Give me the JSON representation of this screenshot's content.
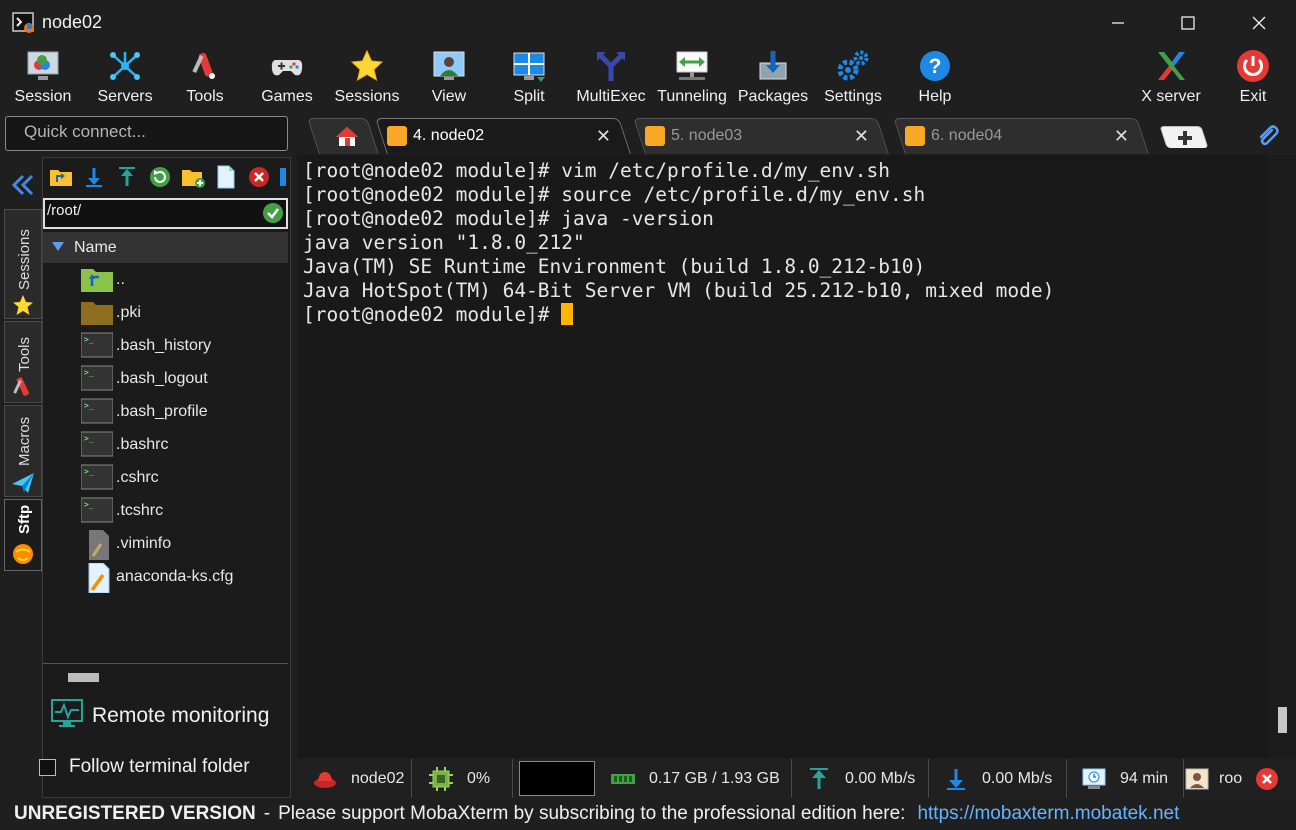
{
  "window": {
    "title": "node02"
  },
  "toolbar": {
    "items": [
      {
        "label": "Session",
        "icon": "session-icon"
      },
      {
        "label": "Servers",
        "icon": "servers-icon"
      },
      {
        "label": "Tools",
        "icon": "tools-icon"
      },
      {
        "label": "Games",
        "icon": "gamepad-icon"
      },
      {
        "label": "Sessions",
        "icon": "star-icon"
      },
      {
        "label": "View",
        "icon": "view-icon"
      },
      {
        "label": "Split",
        "icon": "split-icon"
      },
      {
        "label": "MultiExec",
        "icon": "fork-icon"
      },
      {
        "label": "Tunneling",
        "icon": "tunnel-icon"
      },
      {
        "label": "Packages",
        "icon": "package-icon"
      },
      {
        "label": "Settings",
        "icon": "gears-icon"
      },
      {
        "label": "Help",
        "icon": "help-icon"
      },
      {
        "label": "X server",
        "icon": "x-server-icon"
      },
      {
        "label": "Exit",
        "icon": "power-icon"
      }
    ]
  },
  "quick_connect": {
    "placeholder": "Quick connect..."
  },
  "tabs": [
    {
      "label": "4. node02",
      "active": true
    },
    {
      "label": "5. node03",
      "active": false
    },
    {
      "label": "6. node04",
      "active": false
    }
  ],
  "sidebar": {
    "vtabs": [
      {
        "label": "Sessions"
      },
      {
        "label": "Tools"
      },
      {
        "label": "Macros"
      },
      {
        "label": "Sftp"
      }
    ]
  },
  "sftp": {
    "path": "/root/",
    "column_name": "Name",
    "files": [
      {
        "name": "..",
        "type": "parent"
      },
      {
        "name": ".pki",
        "type": "folder"
      },
      {
        "name": ".bash_history",
        "type": "script"
      },
      {
        "name": ".bash_logout",
        "type": "script"
      },
      {
        "name": ".bash_profile",
        "type": "script"
      },
      {
        "name": ".bashrc",
        "type": "script"
      },
      {
        "name": ".cshrc",
        "type": "script"
      },
      {
        "name": ".tcshrc",
        "type": "script"
      },
      {
        "name": ".viminfo",
        "type": "file-gray"
      },
      {
        "name": "anaconda-ks.cfg",
        "type": "file-edit"
      }
    ],
    "remote_monitoring": "Remote monitoring",
    "follow_terminal_folder": "Follow terminal folder"
  },
  "terminal": {
    "lines": [
      "[root@node02 module]# vim /etc/profile.d/my_env.sh",
      "[root@node02 module]# source /etc/profile.d/my_env.sh",
      "[root@node02 module]# java -version",
      "java version \"1.8.0_212\"",
      "Java(TM) SE Runtime Environment (build 1.8.0_212-b10)",
      "Java HotSpot(TM) 64-Bit Server VM (build 25.212-b10, mixed mode)",
      "[root@node02 module]# "
    ]
  },
  "statusbar": {
    "host": "node02",
    "cpu": "0%",
    "memory": "0.17 GB / 1.93 GB",
    "upload": "0.00 Mb/s",
    "download": "0.00 Mb/s",
    "uptime": "94 min",
    "user": "roo"
  },
  "banner": {
    "unregistered": "UNREGISTERED VERSION",
    "separator": "-",
    "message": "Please support MobaXterm by subscribing to the professional edition here:",
    "link": "https://mobaxterm.mobatek.net"
  },
  "colors": {
    "cursor": "#ffb400",
    "link": "#66b3ff",
    "exit_red": "#e53935"
  }
}
